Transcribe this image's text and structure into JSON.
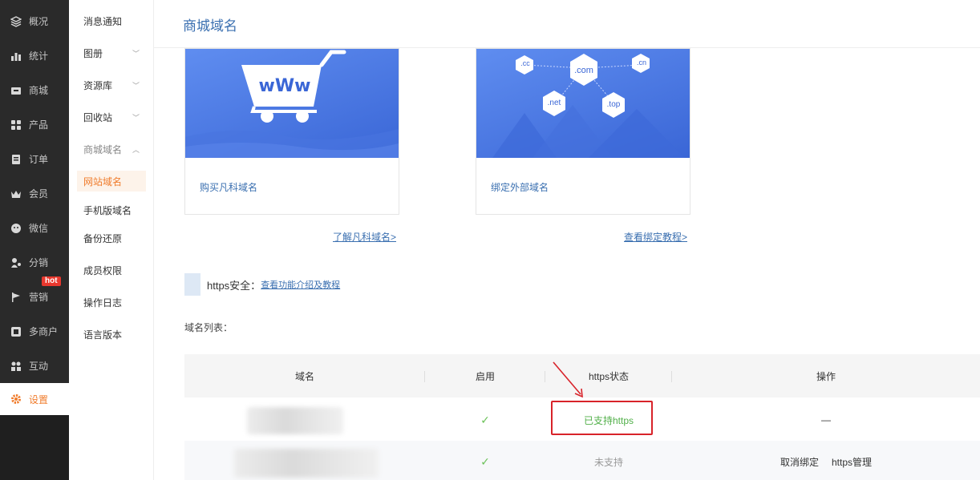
{
  "leftnav": {
    "items": [
      {
        "label": "概况",
        "icon": "layers-icon"
      },
      {
        "label": "统计",
        "icon": "chart-icon"
      },
      {
        "label": "商城",
        "icon": "store-icon"
      },
      {
        "label": "产品",
        "icon": "grid-icon"
      },
      {
        "label": "订单",
        "icon": "order-icon"
      },
      {
        "label": "会员",
        "icon": "crown-icon"
      },
      {
        "label": "微信",
        "icon": "wechat-icon"
      },
      {
        "label": "分销",
        "icon": "share-icon"
      },
      {
        "label": "营销",
        "icon": "flag-icon"
      },
      {
        "label": "多商户",
        "icon": "shop-icon"
      },
      {
        "label": "互动",
        "icon": "interact-icon"
      },
      {
        "label": "设置",
        "icon": "gear-icon"
      }
    ],
    "hot_badge": "hot"
  },
  "subnav": {
    "items": [
      {
        "label": "消息通知"
      },
      {
        "label": "图册"
      },
      {
        "label": "资源库"
      },
      {
        "label": "回收站"
      },
      {
        "label": "商城域名"
      },
      {
        "label": "网站域名"
      },
      {
        "label": "手机版域名"
      },
      {
        "label": "备份还原"
      },
      {
        "label": "成员权限"
      },
      {
        "label": "操作日志"
      },
      {
        "label": "语言版本"
      }
    ]
  },
  "header": {
    "title": "商城域名"
  },
  "cards": [
    {
      "label": "购买凡科域名",
      "link": "了解凡科域名>",
      "banner_text": "wWw"
    },
    {
      "label": "绑定外部域名",
      "link": "查看绑定教程>",
      "tlds": [
        ".cc",
        ".com",
        ".cn",
        ".net",
        ".top"
      ]
    }
  ],
  "https": {
    "label": "https安全：",
    "link": "查看功能介绍及教程"
  },
  "list": {
    "label": "域名列表："
  },
  "table": {
    "headers": [
      "域名",
      "启用",
      "https状态",
      "操作"
    ],
    "rows": [
      {
        "enabled": "✓",
        "https": "已支持https",
        "actions": "—"
      },
      {
        "enabled": "✓",
        "https": "未支持",
        "action1": "取消绑定",
        "action2": "https管理"
      }
    ]
  },
  "colors": {
    "accent": "#f07c2c",
    "link": "#3a6fb0",
    "highlight": "#d8232a",
    "success": "#52b04a"
  }
}
